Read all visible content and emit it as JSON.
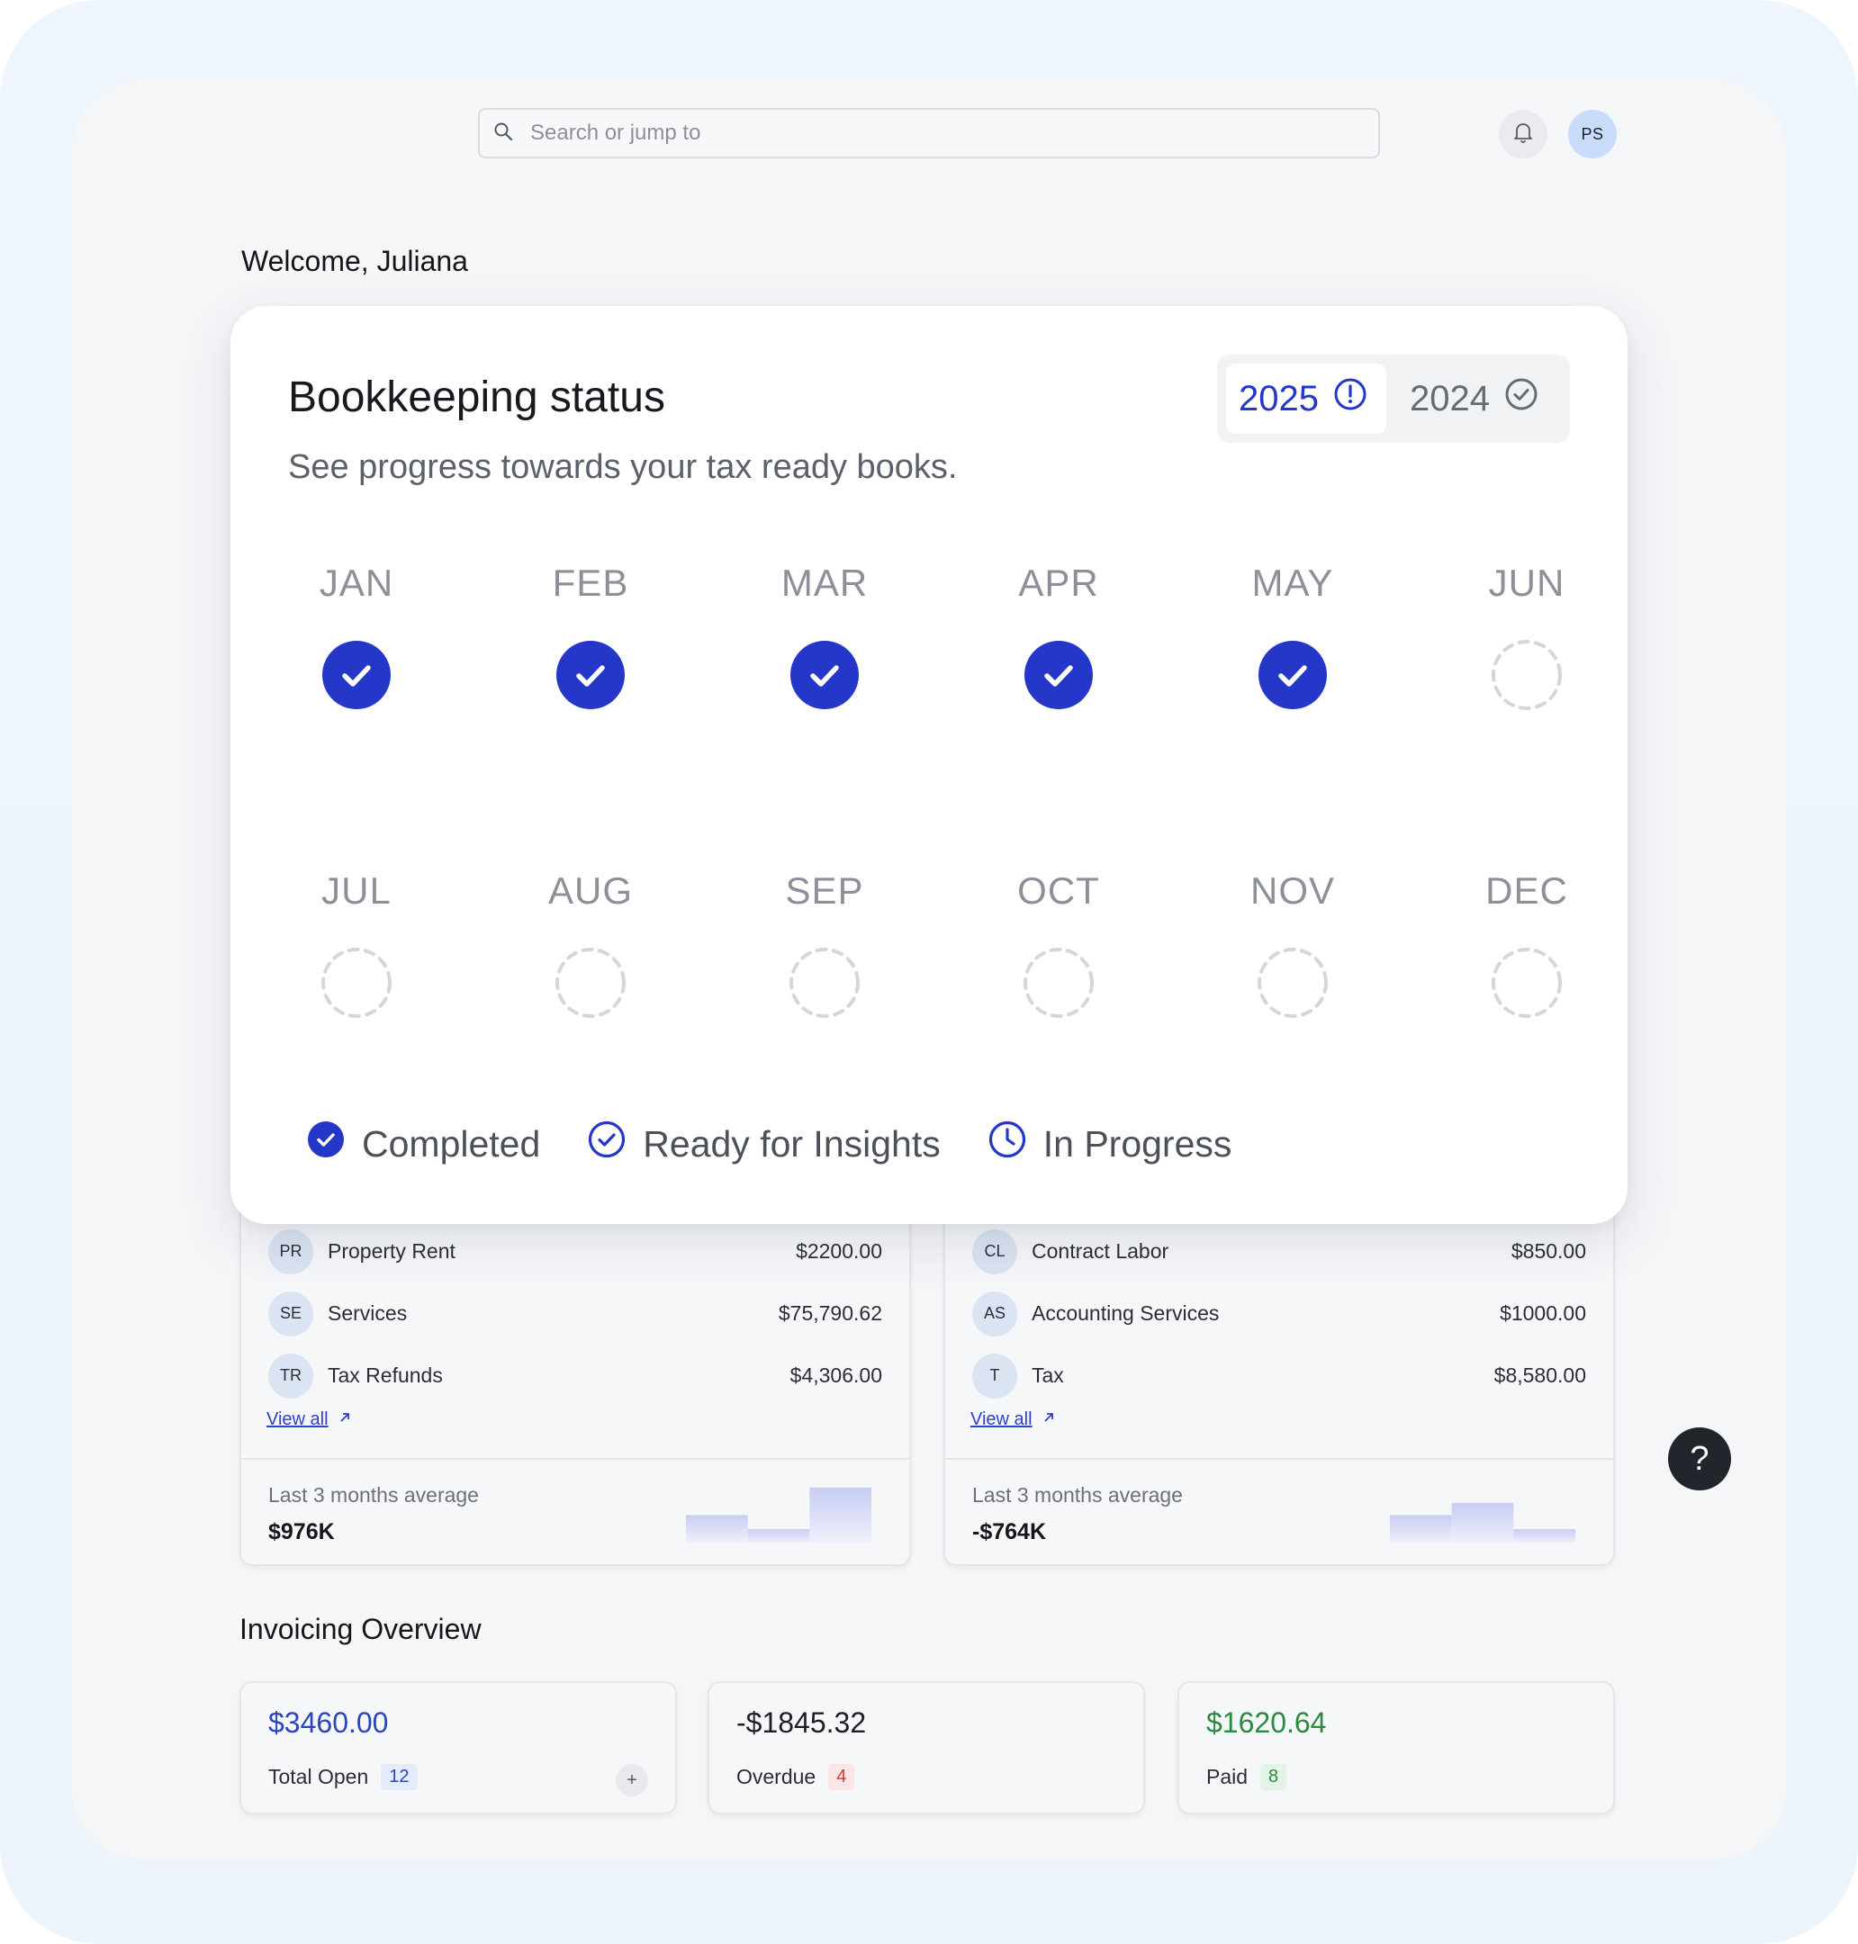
{
  "topbar": {
    "search_placeholder": "Search or jump to",
    "avatar_initials": "PS"
  },
  "welcome": "Welcome, Juliana",
  "bookkeeping": {
    "title": "Bookkeeping status",
    "subtitle": "See progress towards your tax ready books.",
    "years": [
      {
        "label": "2025",
        "active": true,
        "icon": "alert-circle-icon"
      },
      {
        "label": "2024",
        "active": false,
        "icon": "check-circle-icon"
      }
    ],
    "months": [
      {
        "label": "JAN",
        "status": "completed"
      },
      {
        "label": "FEB",
        "status": "completed"
      },
      {
        "label": "MAR",
        "status": "completed"
      },
      {
        "label": "APR",
        "status": "completed"
      },
      {
        "label": "MAY",
        "status": "completed"
      },
      {
        "label": "JUN",
        "status": "pending"
      },
      {
        "label": "JUL",
        "status": "pending"
      },
      {
        "label": "AUG",
        "status": "pending"
      },
      {
        "label": "SEP",
        "status": "pending"
      },
      {
        "label": "OCT",
        "status": "pending"
      },
      {
        "label": "NOV",
        "status": "pending"
      },
      {
        "label": "DEC",
        "status": "pending"
      }
    ],
    "legend": [
      {
        "label": "Completed",
        "icon": "filled-check-circle-icon"
      },
      {
        "label": "Ready for Insights",
        "icon": "outline-check-circle-icon"
      },
      {
        "label": "In Progress",
        "icon": "clock-icon"
      }
    ]
  },
  "income_card": {
    "rows": [
      {
        "initials": "PR",
        "label": "Property Rent",
        "amount": "$2200.00"
      },
      {
        "initials": "SE",
        "label": "Services",
        "amount": "$75,790.62"
      },
      {
        "initials": "TR",
        "label": "Tax Refunds",
        "amount": "$4,306.00"
      }
    ],
    "view_all": "View all",
    "avg_label": "Last 3 months average",
    "avg_value": "$976K",
    "sparkline": [
      0.45,
      0.22,
      0.9
    ]
  },
  "expense_card": {
    "rows": [
      {
        "initials": "CL",
        "label": "Contract Labor",
        "amount": "$850.00"
      },
      {
        "initials": "AS",
        "label": "Accounting Services",
        "amount": "$1000.00"
      },
      {
        "initials": "T",
        "label": "Tax",
        "amount": "$8,580.00"
      }
    ],
    "view_all": "View all",
    "avg_label": "Last 3 months average",
    "avg_value": "-$764K",
    "sparkline": [
      0.45,
      0.65,
      0.22
    ]
  },
  "help_label": "?",
  "invoicing": {
    "title": "Invoicing Overview",
    "cards": [
      {
        "value": "$3460.00",
        "label": "Total Open",
        "count": "12",
        "value_color": "#2d44c0",
        "badge_bg": "#e4ebfb",
        "badge_color": "#2d44c0"
      },
      {
        "value": "-$1845.32",
        "label": "Overdue",
        "count": "4",
        "value_color": "#1d1f24",
        "badge_bg": "#fbe6e6",
        "badge_color": "#d23a3a"
      },
      {
        "value": "$1620.64",
        "label": "Paid",
        "count": "8",
        "value_color": "#2a8a3e",
        "badge_bg": "#e3f4e6",
        "badge_color": "#2a8a3e"
      }
    ]
  },
  "colors": {
    "accent": "#2437c8",
    "pending_ring": "#d3d6dc"
  }
}
